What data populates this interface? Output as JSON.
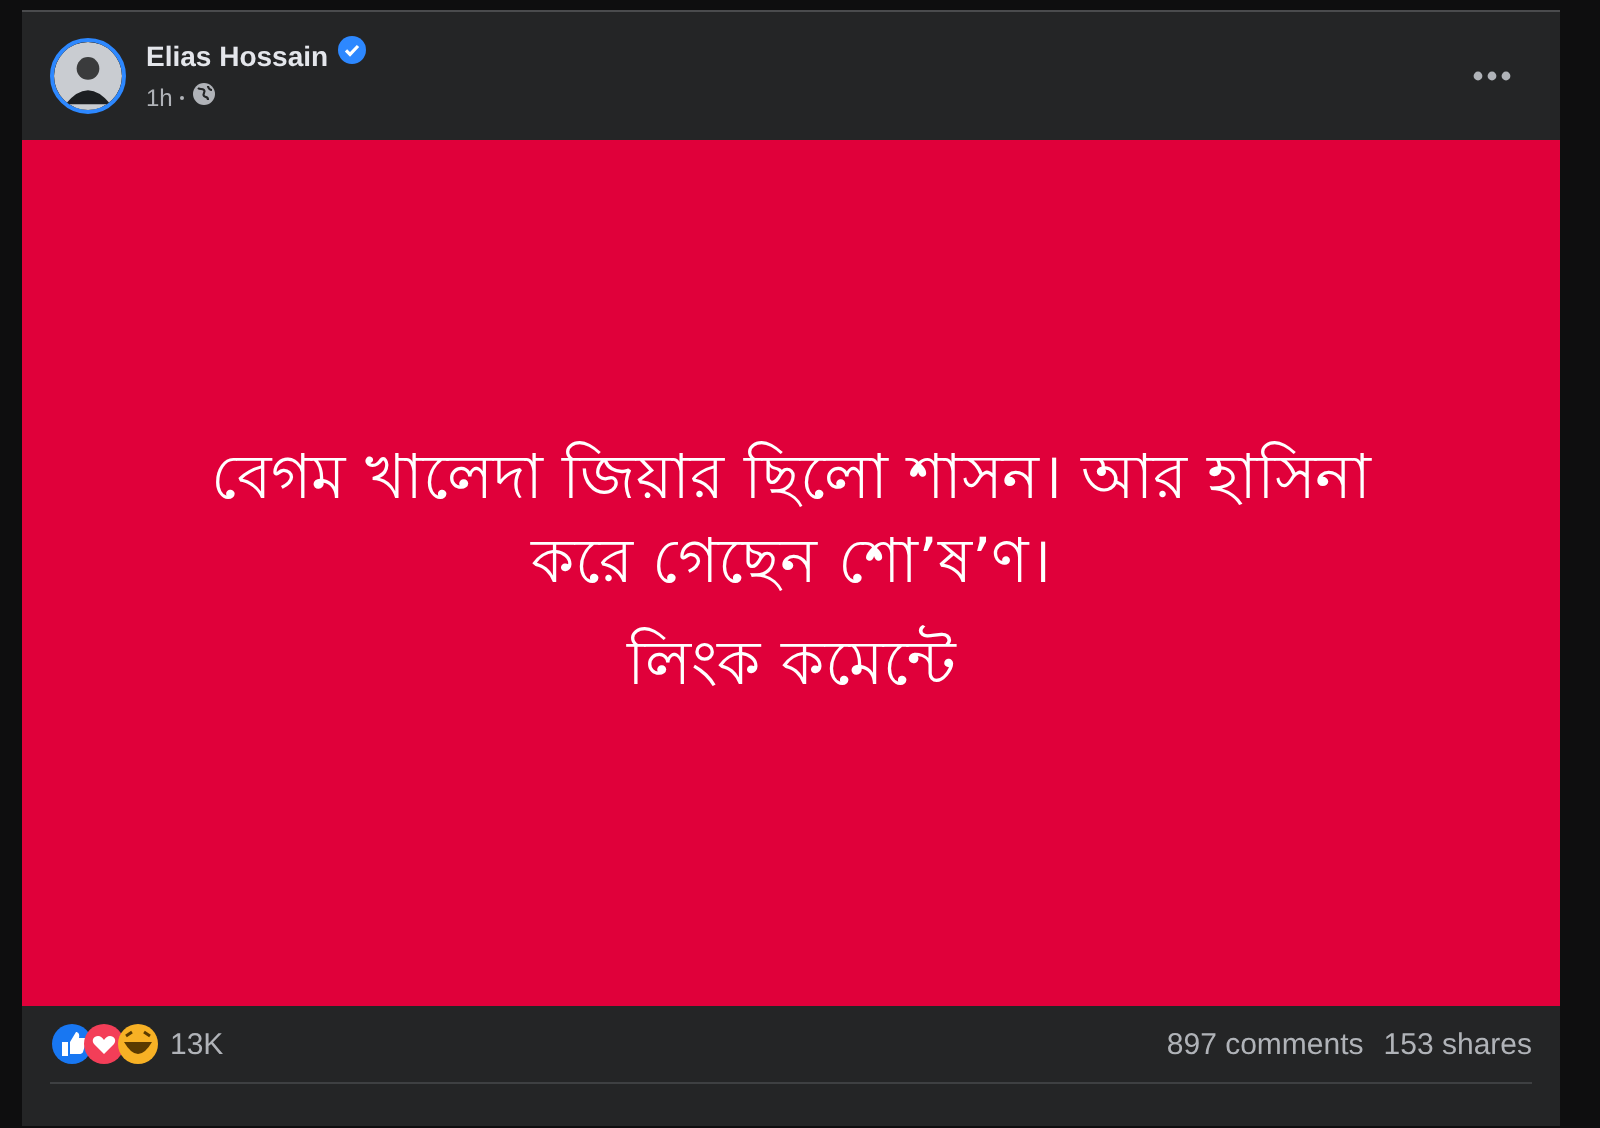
{
  "post": {
    "author": "Elias Hossain",
    "verified": true,
    "time": "1h",
    "paragraphs": [
      "বেগম খালেদা জিয়ার ছিলো শাসন। আর হাসিনা করে গেছেন শো’ষ’ণ।",
      "লিংক কমেন্টে"
    ],
    "reactions": {
      "count": "13K",
      "comments": "897 comments",
      "shares": "153 shares"
    }
  }
}
